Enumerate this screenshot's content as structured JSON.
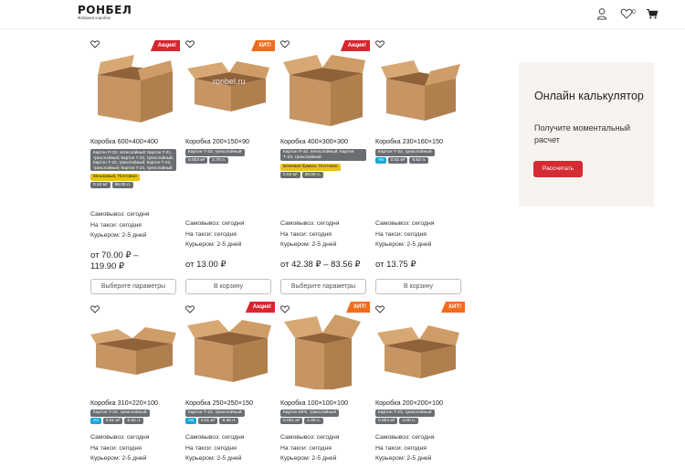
{
  "header": {
    "logo_main": "РОНБЕЛ",
    "logo_sub": "Фабрика коробок",
    "wishlist_count": "0"
  },
  "products": [
    {
      "title": "Коробка 600×400×400",
      "badge": "Акция!",
      "material": "Картон П-32, пятислойный; Картон Т-21, трехслойный; Картон Т-22, трехслойный; Картон Т-23, трехслойный; Картон Т-23, трехслойный; Картон Т-24, трехслойный",
      "coating": "Мешковый, Почтовое",
      "area": "0.10 м²",
      "qty": "96.00 л.",
      "pickup": "Самовывоз: сегодня",
      "taxi": "На такси: сегодня",
      "courier": "Курьером: 2-5 дней",
      "price_line1": "от 70.00 ₽ –",
      "price_line2": "119.90 ₽",
      "button": "Выберите параметры"
    },
    {
      "title": "Коробка 200×150×90",
      "badge": "ХИТ!",
      "watermark": "ronbel.ru",
      "material": "Картон Т-23, трехслойный",
      "area": "0.003 м²",
      "qty": "2.70 л.",
      "pickup": "Самовывоз: сегодня",
      "taxi": "На такси: сегодня",
      "courier": "Курьером: 2-5 дней",
      "price_line1": "от 13.00 ₽",
      "button": "В корзину"
    },
    {
      "title": "Коробка 400×300×300",
      "badge": "Акция!",
      "material": "Картон П-32, пятислойный; Картон Т-23, трехслойный",
      "coating": "Бежевая бумага, Почтовое",
      "area": "0.04 м²",
      "qty": "36.00 л.",
      "pickup": "Самовывоз: сегодня",
      "taxi": "На такси: сегодня",
      "courier": "Курьером: 2-5 дней",
      "price_line1": "от 42.38 ₽ – 83.56 ₽",
      "button": "Выберите параметры"
    },
    {
      "title": "Коробка 230×160×150",
      "material": "Картон Т-22, трехслойный",
      "format": "А5",
      "area": "0.01 м²",
      "qty": "5.52 л.",
      "pickup": "Самовывоз: сегодня",
      "taxi": "На такси: сегодня",
      "courier": "Курьером: 2-5 дней",
      "price_line1": "от 13.75 ₽",
      "button": "В корзину"
    },
    {
      "title": "Коробка 310×220×100",
      "material": "Картон Т-22, трехслойный",
      "format": "А4",
      "area": "0.01 м²",
      "qty": "6.82 л.",
      "pickup": "Самовывоз: сегодня",
      "taxi": "На такси: сегодня",
      "courier": "Курьером: 2-5 дней"
    },
    {
      "title": "Коробка 250×250×150",
      "badge": "Акция!",
      "material": "Картон Т-22, трехслойный",
      "format": "А5",
      "area": "0.01 м²",
      "qty": "9.38 л.",
      "pickup": "Самовывоз: сегодня",
      "taxi": "На такси: сегодня",
      "courier": "Курьером: 2-5 дней"
    },
    {
      "title": "Коробка 100×100×100",
      "badge": "ХИТ!",
      "material": "Картон МГК, трехслойный",
      "area": "0.001 м²",
      "qty": "1.00 л.",
      "pickup": "Самовывоз: сегодня",
      "taxi": "На такси: сегодня",
      "courier": "Курьером: 2-5 дней"
    },
    {
      "title": "Коробка 200×200×100",
      "badge": "ХИТ!",
      "material": "Картон Т-23, трехслойный",
      "area": "0.004 м²",
      "qty": "4.00 л.",
      "pickup": "Самовывоз: сегодня",
      "taxi": "На такси: сегодня",
      "courier": "Курьером: 2-5 дней"
    }
  ],
  "calculator": {
    "title": "Онлайн калькулятор",
    "subtitle": "Получите моментальный расчет",
    "button": "Рассчитать"
  },
  "colors": {
    "accent_red": "#d9252e",
    "hit_orange": "#f26b1d",
    "spec_grey": "#6a6e73",
    "spec_yellow": "#e8c21c",
    "spec_cyan": "#19a7d8",
    "cardboard": "#c69563"
  }
}
